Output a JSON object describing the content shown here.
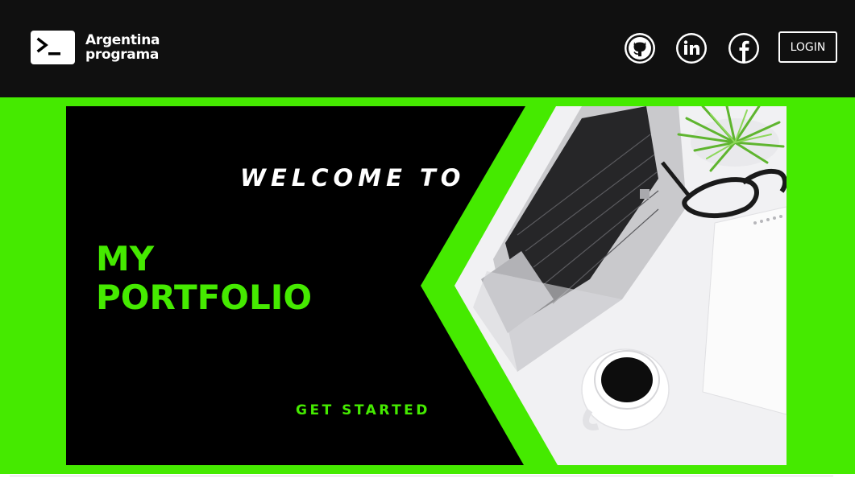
{
  "header": {
    "brand": {
      "line1": "Argentina",
      "line2": "programa",
      "icon": "terminal-prompt-icon"
    },
    "social": [
      {
        "name": "github",
        "icon": "github-icon"
      },
      {
        "name": "linkedin",
        "icon": "linkedin-icon"
      },
      {
        "name": "facebook",
        "icon": "facebook-icon"
      }
    ],
    "login_label": "LOGIN"
  },
  "hero": {
    "welcome": "WELCOME TO",
    "title_line1": "MY",
    "title_line2": "PORTFOLIO",
    "cta_label": "GET STARTED",
    "image": "desk-workspace-photo"
  },
  "colors": {
    "header_bg": "#101010",
    "accent_green": "#45ea00",
    "banner_bg": "#000000",
    "text_white": "#ffffff"
  }
}
